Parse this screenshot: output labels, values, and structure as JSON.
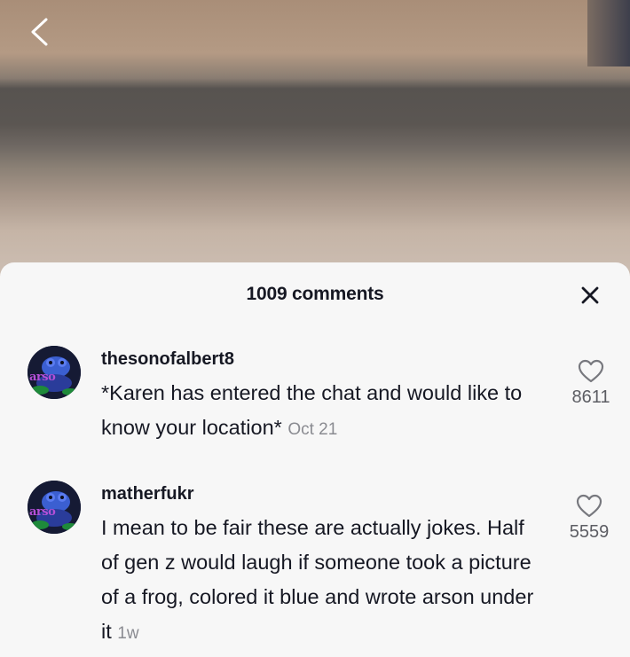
{
  "sheet": {
    "comment_count_label": "1009 comments"
  },
  "comments": [
    {
      "username": "thesonofalbert8",
      "avatar_text": "arso",
      "text": "*Karen has entered the chat and would like to know your location*",
      "timestamp": "Oct 21",
      "likes": "8611"
    },
    {
      "username": "matherfukr",
      "avatar_text": "arso",
      "text": "I mean to be fair these are actually jokes. Half of gen z would laugh if someone took a picture of a frog, colored it blue and wrote arson under it",
      "timestamp": "1w",
      "likes": "5559"
    }
  ],
  "icons": {
    "back": "chevron-left-icon",
    "close": "close-icon",
    "like": "heart-outline-icon"
  },
  "colors": {
    "sheet_bg": "#f7f7f7",
    "text_primary": "#161823",
    "text_secondary": "#8a8b91"
  }
}
